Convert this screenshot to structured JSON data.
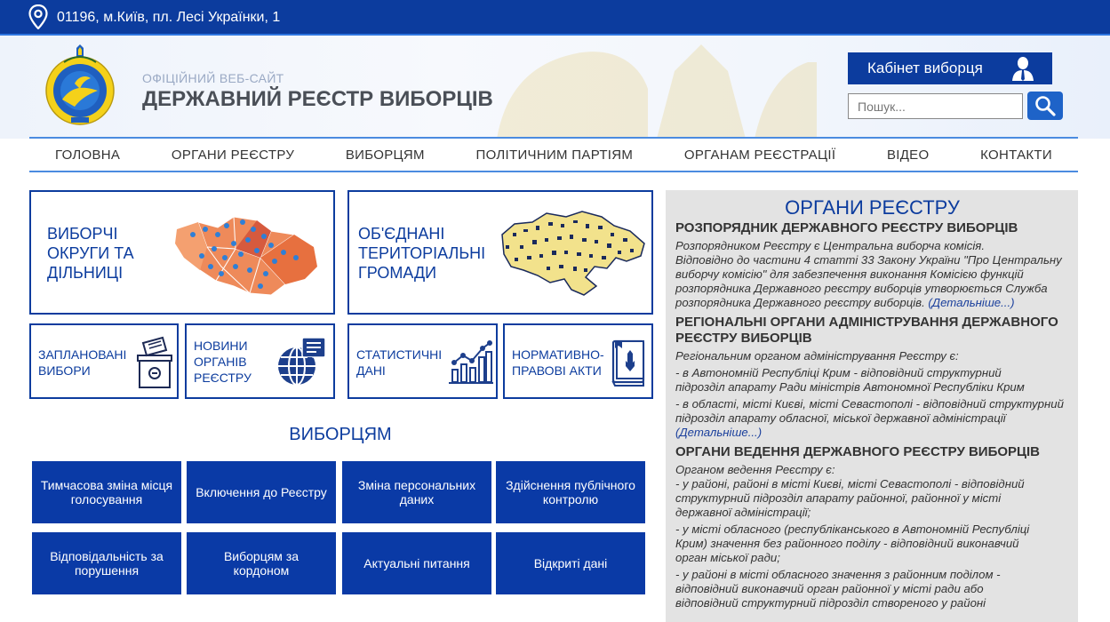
{
  "topbar": {
    "address": "01196, м.Київ, пл. Лесі Українки, 1",
    "pin_icon": "location-pin-icon"
  },
  "header": {
    "subtitle": "ОФІЦІЙНИЙ ВЕБ-САЙТ",
    "title": "ДЕРЖАВНИЙ РЕЄСТР ВИБОРЦІВ",
    "cabinet_label": "Кабінет виборця",
    "search_placeholder": "Пошук..."
  },
  "nav": [
    "ГОЛОВНА",
    "ОРГАНИ РЕЄСТРУ",
    "ВИБОРЦЯМ",
    "ПОЛІТИЧНИМ ПАРТІЯМ",
    "ОРГАНАМ РЕЄСТРАЦІЇ",
    "ВІДЕО",
    "КОНТАКТИ"
  ],
  "tiles_big": [
    {
      "label_lines": [
        "Виборчі",
        "округи та",
        "дільниці"
      ],
      "icon": "district-map-icon"
    },
    {
      "label_lines": [
        "Об'єднані",
        "територіальні",
        "громади"
      ],
      "icon": "ukraine-map-icon"
    }
  ],
  "tiles_small": [
    {
      "label_lines": [
        "Заплановані",
        "вибори"
      ],
      "icon": "ballot-box-icon"
    },
    {
      "label_lines": [
        "Новини",
        "органів",
        "реєстру"
      ],
      "icon": "globe-news-icon"
    },
    {
      "label_lines": [
        "Статистичні",
        "дані"
      ],
      "icon": "bar-chart-icon"
    },
    {
      "label_lines": [
        "Нормативно-",
        "правові акти"
      ],
      "icon": "law-book-icon"
    }
  ],
  "voters_section": {
    "title": "ВИБОРЦЯМ",
    "buttons": [
      [
        "Тимчасова зміна місця",
        "голосування"
      ],
      [
        "Включення до Реєстру"
      ],
      [
        "Зміна персональних",
        "даних"
      ],
      [
        "Здійснення публічного",
        "контролю"
      ],
      [
        "Відповідальність за",
        "порушення"
      ],
      [
        "Виборцям за",
        "кордоном"
      ],
      [
        "Актуальні питання"
      ],
      [
        "Відкриті дані"
      ]
    ]
  },
  "panel": {
    "title": "ОРГАНИ РЕЄСТРУ",
    "s1": {
      "heading": "РОЗПОРЯДНИК ДЕРЖАВНОГО РЕЄСТРУ ВИБОРЦІВ",
      "lines": [
        "Розпорядником Реєстру є Центральна виборча комісія.",
        "Відповідно до частини 4 статті 33 Закону України \"Про Центральну",
        "виборчу комісію\" для забезпечення виконання Комісією функцій",
        "розпорядника Державного реєстру виборців утворюється Служба"
      ],
      "last_line": "розпорядника Державного реєстру виборців.",
      "more": "(Детальніше...)"
    },
    "s2": {
      "heading_lines": [
        "РЕГІОНАЛЬНІ ОРГАНИ АДМІНІСТРУВАННЯ ДЕРЖАВНОГО",
        "РЕЄСТРУ ВИБОРЦІВ"
      ],
      "intro": "Регіональним органом адміністрування Реєстру є:",
      "lines": [
        "- в Автономній Республіці Крим - відповідний структурний",
        "підрозділ апарату Ради міністрів Автономної Республіки Крим",
        "- в області, місті Києві, місті Севастополі - відповідний структурний",
        "підрозділ апарату обласної, міської державної адміністрації"
      ],
      "more": "(Детальніше...)"
    },
    "s3": {
      "heading": "ОРГАНИ ВЕДЕННЯ ДЕРЖАВНОГО РЕЄСТРУ ВИБОРЦІВ",
      "intro": "Органом ведення Реєстру є:",
      "lines": [
        "- у районі, районі в місті Києві, місті Севастополі - відповідний",
        "структурний підрозділ апарату районної, районної у місті",
        "державної адміністрації;",
        "- у місті обласного (республіканського в Автономній Республіці",
        "Крим) значення без районного поділу - відповідний виконавчий",
        "орган міської ради;",
        "- у районі в місті обласного значення з районним поділом -",
        "відповідний виконавчий орган районної у місті ради або",
        "відповідний структурний підрозділ створеного у районі"
      ]
    }
  },
  "colors": {
    "primary": "#0c3c9e",
    "accent": "#2f76e0",
    "panel_bg": "#e3e3e3"
  }
}
